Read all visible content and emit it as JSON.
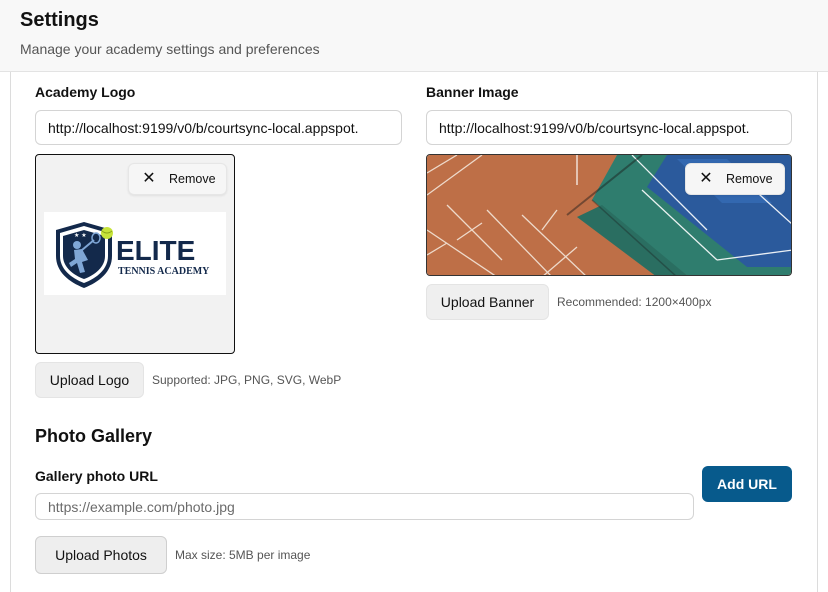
{
  "header": {
    "title": "Settings",
    "subtitle": "Manage your academy settings and preferences"
  },
  "logo": {
    "label": "Academy Logo",
    "url_value": "http://localhost:9199/v0/b/courtsync-local.appspot.",
    "remove_label": "Remove",
    "brand_name": "ELITE",
    "brand_tagline": "TENNIS ACADEMY",
    "upload_label": "Upload Logo",
    "hint": "Supported: JPG, PNG, SVG, WebP"
  },
  "banner": {
    "label": "Banner Image",
    "url_value": "http://localhost:9199/v0/b/courtsync-local.appspot.",
    "remove_label": "Remove",
    "upload_label": "Upload Banner",
    "hint": "Recommended: 1200×400px"
  },
  "gallery": {
    "title": "Photo Gallery",
    "url_label": "Gallery photo URL",
    "url_placeholder": "https://example.com/photo.jpg",
    "add_url_label": "Add URL",
    "upload_label": "Upload Photos",
    "hint": "Max size: 5MB per image"
  },
  "colors": {
    "primary": "#075a8c",
    "logo_navy": "#13294b",
    "logo_ball": "#c6e33a",
    "court_clay": "#c0724a",
    "court_green": "#2f7d6e",
    "court_blue": "#2b5a9c"
  },
  "icons": {
    "remove": "close-icon"
  }
}
